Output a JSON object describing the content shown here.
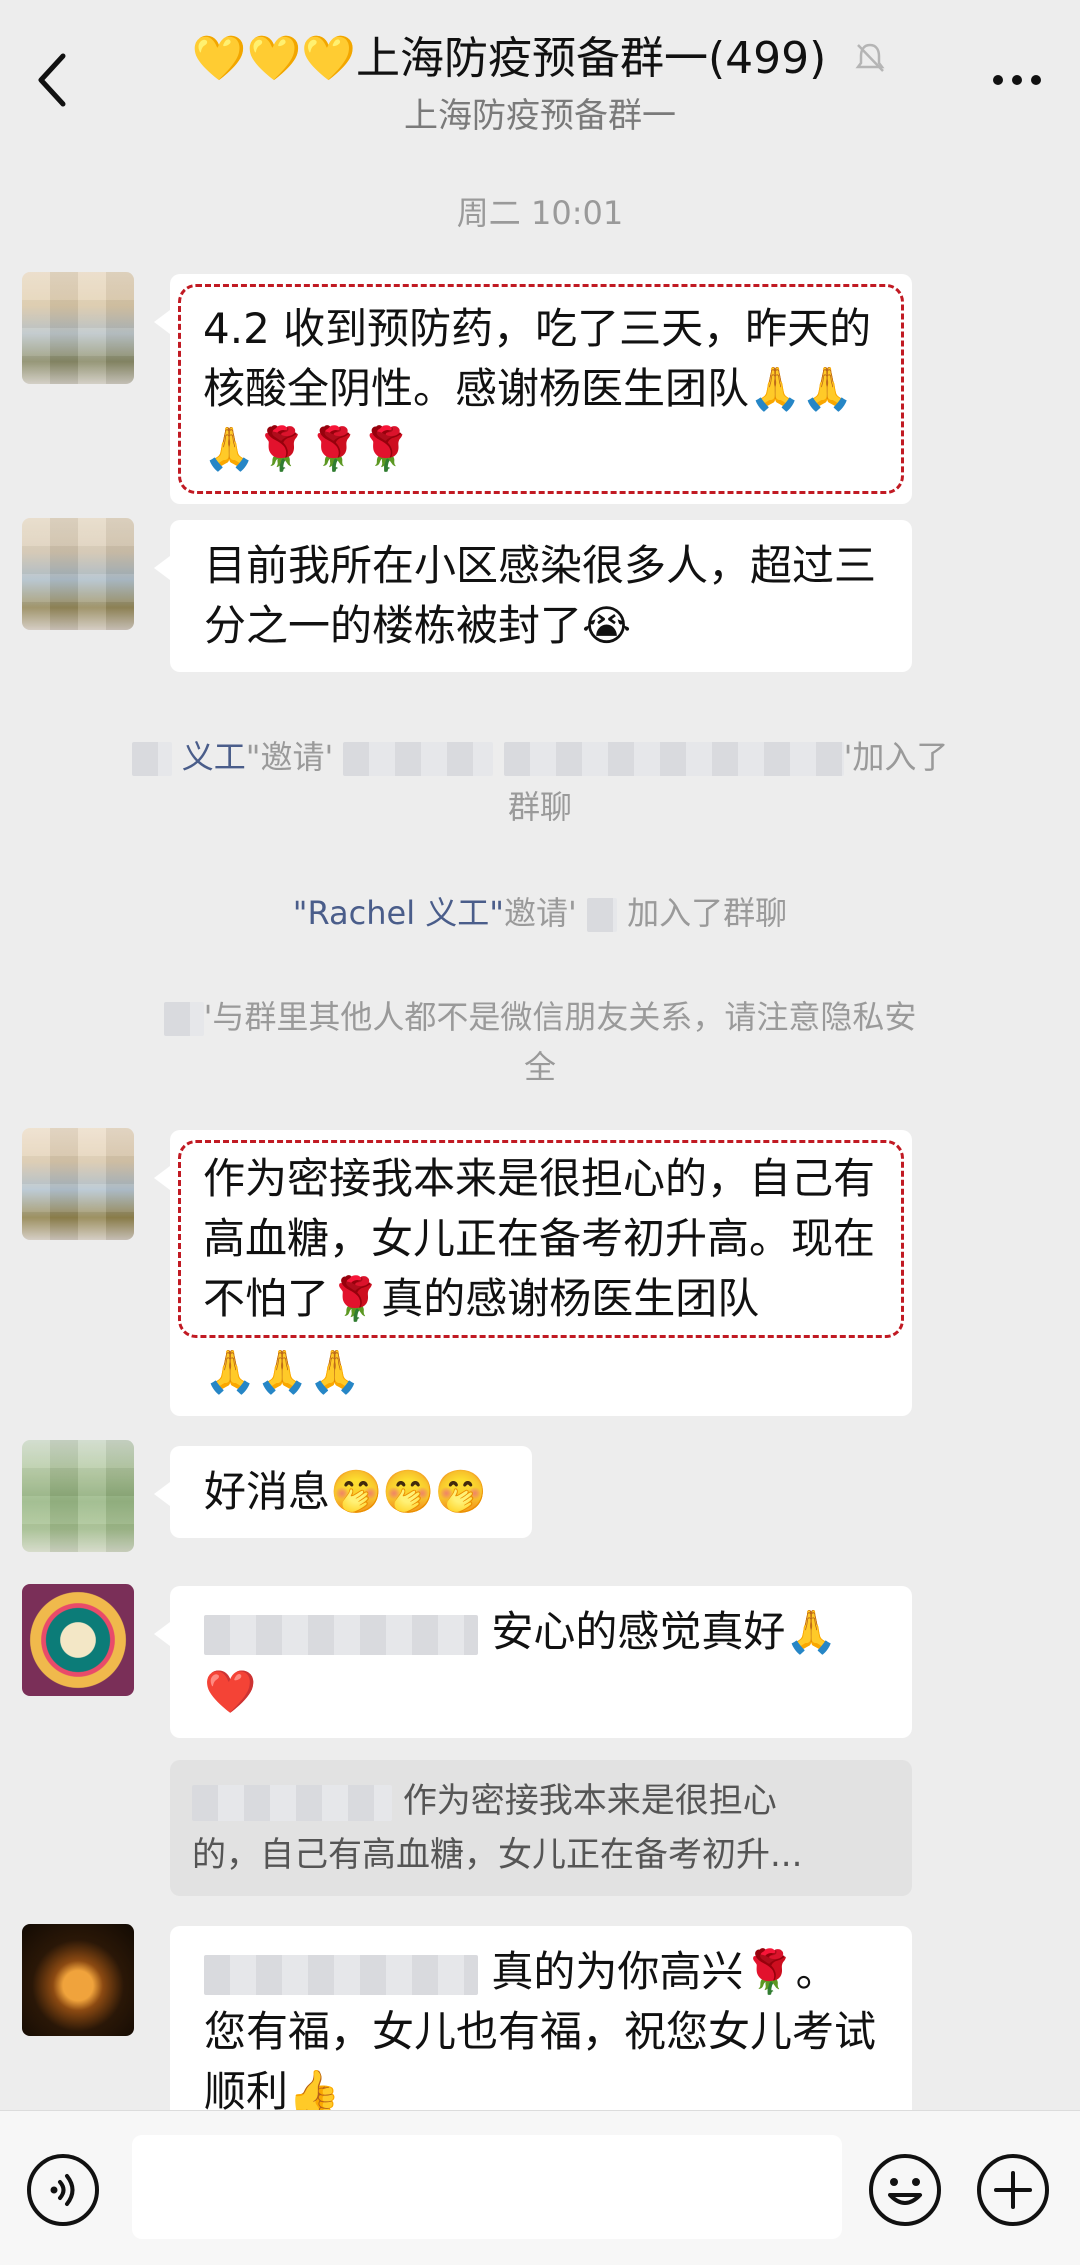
{
  "header": {
    "title_hearts": "💛💛💛",
    "title": "上海防疫预备群一(499)",
    "subtitle": "上海防疫预备群一",
    "more_label": "..."
  },
  "timestamp": "周二 10:01",
  "messages": [
    {
      "text": "4.2 收到预防药，吃了三天，昨天的核酸全阴性。感谢杨医生团队🙏🙏🙏🌹🌹🌹"
    },
    {
      "text": "目前我所在小区感染很多人，超过三分之一的楼栋被封了😭"
    },
    {
      "text": "作为密接我本来是很担心的，自己有高血糖，女儿正在备考初升高。现在不怕了🌹真的感谢杨医生团队",
      "extra": "🙏🙏🙏"
    },
    {
      "text": "好消息🤭🤭🤭"
    },
    {
      "text": "安心的感觉真好🙏",
      "extra": "❤️"
    },
    {
      "text": "真的为你高兴🌹。您有福，女儿也有福，祝您女儿考试顺利👍"
    }
  ],
  "quote": {
    "text_line1": "作为密接我本来是很担心",
    "text_line2": "的，自己有高血糖，女儿正在备考初升..."
  },
  "system": {
    "invite1_name": "义工",
    "invite1_mid": "\"邀请'",
    "invite1_end": "'加入了",
    "invite1_line2": "群聊",
    "invite2_name": "\"Rachel 义工\"",
    "invite2_mid": "邀请'",
    "invite2_end": "加入了群聊",
    "privacy_line1": "'与群里其他人都不是微信朋友关系，请注意隐私安",
    "privacy_line2": "全"
  },
  "colors": {
    "background": "#ededed",
    "bubble": "#ffffff",
    "highlight_border": "#c11a23",
    "system_name": "#4a5d8a",
    "muted_text": "#9a9a9a"
  },
  "icons": [
    "back-icon",
    "mute-bell-icon",
    "more-icon",
    "voice-icon",
    "emoji-icon",
    "plus-icon"
  ]
}
